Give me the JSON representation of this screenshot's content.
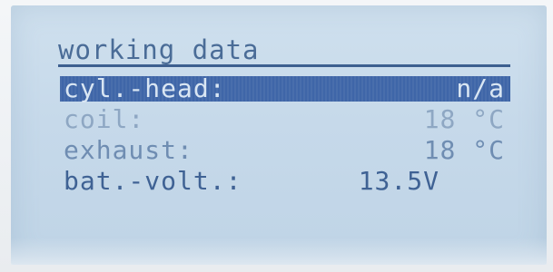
{
  "display": {
    "title": "working data",
    "rows": [
      {
        "label": "cyl.-head:",
        "value": "n/a",
        "selected": true
      },
      {
        "label": "coil:",
        "value": "18 °C",
        "selected": false
      },
      {
        "label": "exhaust:",
        "value": "18 °C",
        "selected": false
      },
      {
        "label": "bat.-volt.:",
        "value": "13.5V",
        "selected": false
      }
    ]
  },
  "colors": {
    "lcd_background": "#c6d9ea",
    "text": "#4d6f99",
    "selection_bar": "#3f66a8"
  }
}
